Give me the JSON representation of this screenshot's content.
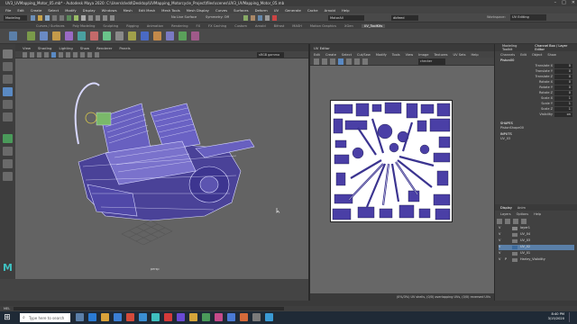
{
  "window": {
    "title": "UV3_UVMapping_Motor_05.mb* - Autodesk Maya 2020: C:\\Users\\dvdd\\Desktop\\UVMapping_Motorcycle_Project\\files\\scenes\\UV3_UVMapping_Motor_05.mb",
    "controls": [
      "–",
      "□",
      "✕"
    ]
  },
  "menubar": [
    "File",
    "Edit",
    "Create",
    "Select",
    "Modify",
    "Display",
    "Windows",
    "Mesh",
    "Edit Mesh",
    "Mesh Tools",
    "Mesh Display",
    "Curves",
    "Surfaces",
    "Deform",
    "UV",
    "Generate",
    "Cache",
    "Arnold",
    "Help"
  ],
  "status": {
    "mode": "Modeling",
    "live_surface": "No Live Surface",
    "symmetry": "Symmetry: Off",
    "object_field": "MotorAll",
    "signed_in": "dbfeed",
    "workspace_label": "Workspace:",
    "workspace_value": "UV Editing"
  },
  "shelf_tabs": [
    "Curves / Surfaces",
    "Poly Modeling",
    "Sculpting",
    "Rigging",
    "Animation",
    "Rendering",
    "FX",
    "FX Caching",
    "Custom",
    "Arnold",
    "Bifrost",
    "MASH",
    "Motion Graphics",
    "XGen",
    "UV_ToolKits"
  ],
  "shelf_active": "UV_ToolKits",
  "viewport": {
    "menu": [
      "View",
      "Shading",
      "Lighting",
      "Show",
      "Renderer",
      "Panels"
    ],
    "gamma_label": "sRGB gamma",
    "camera_label": "persp",
    "resolution": ""
  },
  "uv_editor": {
    "title": "UV Editor",
    "menu": [
      "Edit",
      "Create",
      "Select",
      "Cut/Sew",
      "Modify",
      "Tools",
      "View",
      "Image",
      "Textures",
      "UV Sets",
      "Help"
    ],
    "map_label": "checker",
    "status_text": "(0%/3%) UV shells, (0/0) overlapping UVs, (0/0) reversed UVs"
  },
  "right_panel": {
    "tabs": [
      "Modeling Toolkit",
      "Channel Box / Layer Editor"
    ],
    "subtabs": [
      "Channels",
      "Edit",
      "Object",
      "Show"
    ],
    "object_name": "Piston00",
    "attributes": [
      {
        "label": "Translate X",
        "value": "0"
      },
      {
        "label": "Translate Y",
        "value": "0"
      },
      {
        "label": "Translate Z",
        "value": "0"
      },
      {
        "label": "Rotate X",
        "value": "0"
      },
      {
        "label": "Rotate Y",
        "value": "0"
      },
      {
        "label": "Rotate Z",
        "value": "0"
      },
      {
        "label": "Scale X",
        "value": "1"
      },
      {
        "label": "Scale Y",
        "value": "1"
      },
      {
        "label": "Scale Z",
        "value": "1"
      },
      {
        "label": "Visibility",
        "value": "on"
      }
    ],
    "shapes_label": "SHAPES",
    "shape_name": "PistonShape00",
    "inputs_label": "INPUTS",
    "input_name": "UV_03"
  },
  "layers": {
    "tabs": [
      "Display",
      "Anim"
    ],
    "menu": [
      "Layers",
      "Options",
      "Help"
    ],
    "rows": [
      {
        "v": "V",
        "p": "",
        "name": "layer1",
        "color": "#888888"
      },
      {
        "v": "V",
        "p": "",
        "name": "UV_04",
        "color": "#7a7a7a"
      },
      {
        "v": "V",
        "p": "",
        "name": "UV_03",
        "color": "#7a7a7a"
      },
      {
        "v": "V",
        "p": "",
        "name": "UV_02",
        "color": "#3d6b9c",
        "selected": true
      },
      {
        "v": "V",
        "p": "",
        "name": "UV_01",
        "color": "#7a7a7a"
      },
      {
        "v": "V",
        "p": "P",
        "name": "Harley_Visibility",
        "color": "#7a7a7a"
      }
    ]
  },
  "cmdline": {
    "label": "MEL"
  },
  "taskbar": {
    "search_placeholder": "Type here to search",
    "clock_time": "8:40 PM",
    "clock_date": "3/15/2020"
  },
  "colors": {
    "wire": "#c9c9ff",
    "uv_blue": "#4a3fa6",
    "viewport_bg": "#636363"
  }
}
